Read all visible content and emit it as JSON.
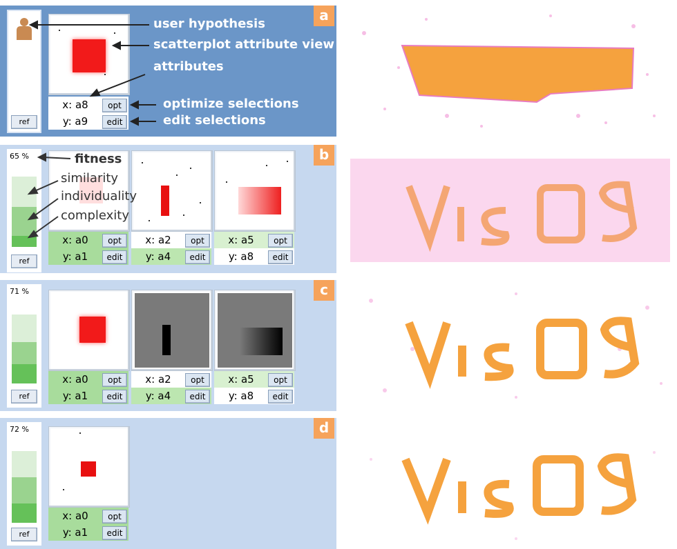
{
  "panels": {
    "a": {
      "letter": "a",
      "ref_label": "ref",
      "plot": {
        "x_label": "x: a8",
        "y_label": "y: a9",
        "opt_label": "opt",
        "edit_label": "edit"
      },
      "annotations": {
        "user_hypothesis": "user hypothesis",
        "scatterplot_view": "scatterplot attribute view",
        "attributes": "attributes",
        "optimize": "optimize selections",
        "edit": "edit selections"
      }
    },
    "b": {
      "letter": "b",
      "fitness_value": "65 %",
      "ref_label": "ref",
      "annotations": {
        "fitness": "fitness",
        "similarity": "similarity",
        "individuality": "individuality",
        "complexity": "complexity"
      },
      "plots": [
        {
          "x_label": "x: a0",
          "y_label": "y: a1",
          "opt_label": "opt",
          "edit_label": "edit"
        },
        {
          "x_label": "x: a2",
          "y_label": "y: a4",
          "opt_label": "opt",
          "edit_label": "edit"
        },
        {
          "x_label": "x: a5",
          "y_label": "y: a8",
          "opt_label": "opt",
          "edit_label": "edit"
        }
      ]
    },
    "c": {
      "letter": "c",
      "fitness_value": "71 %",
      "ref_label": "ref",
      "plots": [
        {
          "x_label": "x: a0",
          "y_label": "y: a1",
          "opt_label": "opt",
          "edit_label": "edit"
        },
        {
          "x_label": "x: a2",
          "y_label": "y: a4",
          "opt_label": "opt",
          "edit_label": "edit"
        },
        {
          "x_label": "x: a5",
          "y_label": "y: a8",
          "opt_label": "opt",
          "edit_label": "edit"
        }
      ]
    },
    "d": {
      "letter": "d",
      "fitness_value": "72 %",
      "ref_label": "ref",
      "plots": [
        {
          "x_label": "x: a0",
          "y_label": "y: a1",
          "opt_label": "opt",
          "edit_label": "edit"
        }
      ]
    }
  },
  "colors": {
    "panel_a_bg": "#6b96c8",
    "panel_bg": "#c6d8ef",
    "letter_badge": "#f6a35b",
    "selection_red": "#ff0000",
    "render_orange": "#f6a840",
    "render_pink": "#f060c0"
  }
}
